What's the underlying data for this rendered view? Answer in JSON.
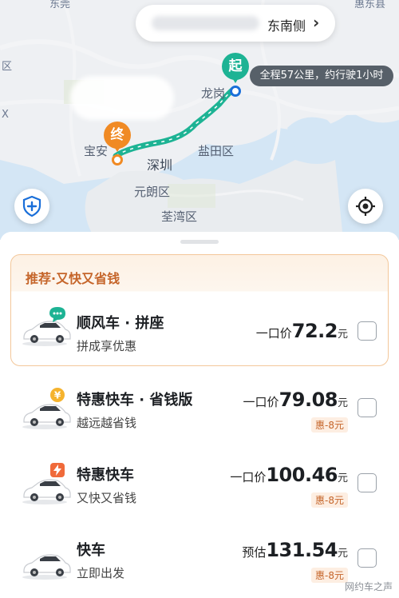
{
  "map": {
    "search_suffix": "东南侧",
    "route_info": "全程57公里，约行驶1小时",
    "start_marker": "起",
    "end_marker": "终",
    "top_fragment_left": "东莞",
    "top_fragment_right": "惠东县",
    "labels": {
      "longgang": "龙岗",
      "baoan": "宝安",
      "shenzhen": "深圳",
      "yantian": "盐田区",
      "yuanlang": "元朗区",
      "quanwan": "荃湾区",
      "frag_qu": "区",
      "frag_x": "X"
    },
    "colors": {
      "route": "#1db394",
      "start": "#1db394",
      "end": "#f08a24",
      "water": "#d4e6f5"
    }
  },
  "icons": {
    "shield": "shield-plus-icon",
    "locate": "locate-icon",
    "arrow": "chevron-right-icon"
  },
  "recommend": {
    "title": "推荐·又快又省钱"
  },
  "options": [
    {
      "name": "顺风车 · 拼座",
      "sub": "拼成享优惠",
      "price_prefix": "一口价",
      "price": "72.2",
      "unit": "元",
      "discount": "",
      "badge": "chat-bubble-icon"
    },
    {
      "name": "特惠快车 · 省钱版",
      "sub": "越远越省钱",
      "price_prefix": "一口价",
      "price": "79.08",
      "unit": "元",
      "discount": "惠-8元",
      "badge": "coin-icon"
    },
    {
      "name": "特惠快车",
      "sub": "又快又省钱",
      "price_prefix": "一口价",
      "price": "100.46",
      "unit": "元",
      "discount": "惠-8元",
      "badge": "lightning-icon"
    },
    {
      "name": "快车",
      "sub": "立即出发",
      "price_prefix": "预估",
      "price": "131.54",
      "unit": "元",
      "discount": "惠-8元",
      "badge": ""
    }
  ],
  "watermark": "网约车之声"
}
